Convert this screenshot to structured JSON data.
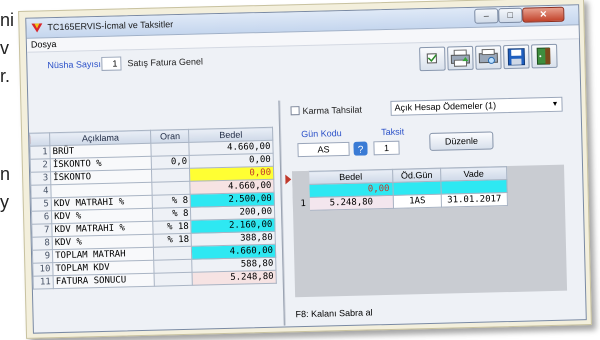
{
  "background_fragments": [
    "ni",
    "v",
    "r.",
    "n",
    "y"
  ],
  "window": {
    "title": "TC165ERVIS-İcmal ve Taksitler",
    "menu": [
      "Dosya"
    ]
  },
  "header": {
    "nusha_label": "Nüsha Sayısı",
    "nusha_value": "1",
    "doc_type": "Satış Fatura Genel"
  },
  "toolbar": {
    "icons": [
      "checkbox-icon",
      "print-icon",
      "print-preview-icon",
      "save-icon",
      "exit-icon"
    ]
  },
  "left_table": {
    "columns": [
      "Açıklama",
      "Oran",
      "Bedel"
    ],
    "rows": [
      {
        "no": "1",
        "desc": "BRÜT",
        "oran": "",
        "bedel": "4.660,00",
        "style": ""
      },
      {
        "no": "2",
        "desc": "İSKONTO %",
        "oran": "0,0",
        "bedel": "0,00",
        "style": ""
      },
      {
        "no": "3",
        "desc": "İSKONTO",
        "oran": "",
        "bedel": "0,00",
        "style": "yellow"
      },
      {
        "no": "4",
        "desc": "",
        "oran": "",
        "bedel": "4.660,00",
        "style": "pink"
      },
      {
        "no": "5",
        "desc": "KDV MATRAHI %",
        "oran": "% 8",
        "bedel": "2.500,00",
        "style": "cyan"
      },
      {
        "no": "6",
        "desc": "KDV %",
        "oran": "% 8",
        "bedel": "200,00",
        "style": ""
      },
      {
        "no": "7",
        "desc": "KDV MATRAHI %",
        "oran": "% 18",
        "bedel": "2.160,00",
        "style": "cyan"
      },
      {
        "no": "8",
        "desc": "KDV %",
        "oran": "% 18",
        "bedel": "388,80",
        "style": ""
      },
      {
        "no": "9",
        "desc": "TOPLAM MATRAH",
        "oran": "",
        "bedel": "4.660,00",
        "style": "cyan"
      },
      {
        "no": "10",
        "desc": "TOPLAM KDV",
        "oran": "",
        "bedel": "588,80",
        "style": ""
      },
      {
        "no": "11",
        "desc": "FATURA SONUCU",
        "oran": "",
        "bedel": "5.248,80",
        "style": "pink"
      }
    ]
  },
  "right_panel": {
    "karma_label": "Karma Tahsilat",
    "payment_combo": "Açık Hesap Ödemeler (1)",
    "gun_kodu_label": "Gün Kodu",
    "gun_kodu_value": "AS",
    "taksit_label": "Taksit",
    "taksit_value": "1",
    "duzenle_label": "Düzenle",
    "columns": [
      "Bedel",
      "Öd.Gün",
      "Vade"
    ],
    "summary_value": "0,00",
    "rows": [
      {
        "no": "1",
        "bedel": "5.248,80",
        "odgun": "1AS",
        "vade": "31.01.2017"
      }
    ],
    "footer": "F8: Kalanı Sabra al"
  },
  "colors": {
    "yellow": "#ffff33",
    "cyan": "#2ee8f2",
    "pink": "#f6e3e3",
    "label_blue": "#2a50c8"
  }
}
